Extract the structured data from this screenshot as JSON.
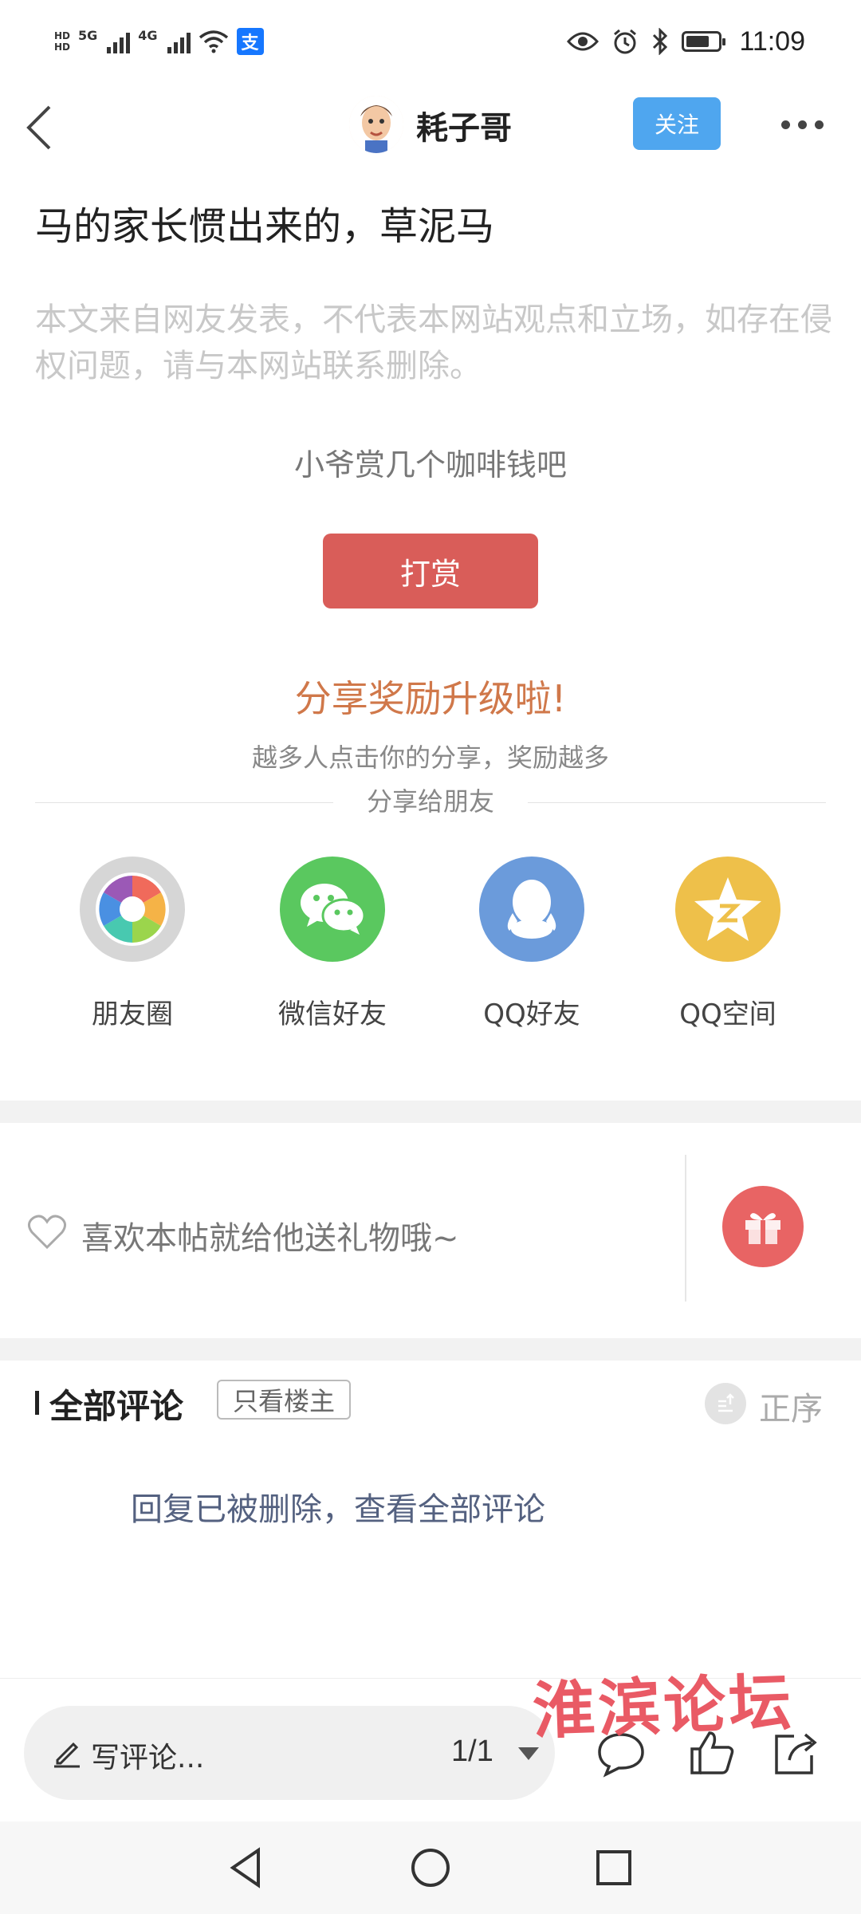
{
  "status_bar": {
    "hd1": "HD",
    "hd2": "HD",
    "net1": "5G",
    "net2": "4G",
    "alipay_glyph": "支",
    "time": "11:09",
    "icons": [
      "eye-icon",
      "alarm-icon",
      "bluetooth-icon",
      "battery-icon"
    ]
  },
  "header": {
    "author": "耗子哥",
    "follow_label": "关注"
  },
  "post": {
    "title": "马的家长惯出来的，草泥马",
    "disclaimer": "本文来自网友发表，不代表本网站观点和立场，如存在侵权问题，请与本网站联系删除。",
    "reward_prompt": "小爷赏几个咖啡钱吧",
    "reward_button": "打赏"
  },
  "share": {
    "title": "分享奖励升级啦!",
    "subtitle": "越多人点击你的分享，奖励越多",
    "share_to": "分享给朋友",
    "targets": [
      {
        "label": "朋友圈",
        "icon": "moments-icon",
        "color": "#d6d6d6"
      },
      {
        "label": "微信好友",
        "icon": "wechat-icon",
        "color": "#5ac85f"
      },
      {
        "label": "QQ好友",
        "icon": "qq-icon",
        "color": "#6b9bdb"
      },
      {
        "label": "QQ空间",
        "icon": "qzone-icon",
        "color": "#eec04a"
      }
    ]
  },
  "gift": {
    "prompt": "喜欢本帖就给他送礼物哦~"
  },
  "comments": {
    "title": "全部评论",
    "only_op": "只看楼主",
    "order": "正序",
    "deleted_note": "回复已被删除，查看全部评论"
  },
  "bottom_bar": {
    "placeholder": "写评论...",
    "page": "1/1"
  },
  "watermark": "淮滨论坛"
}
